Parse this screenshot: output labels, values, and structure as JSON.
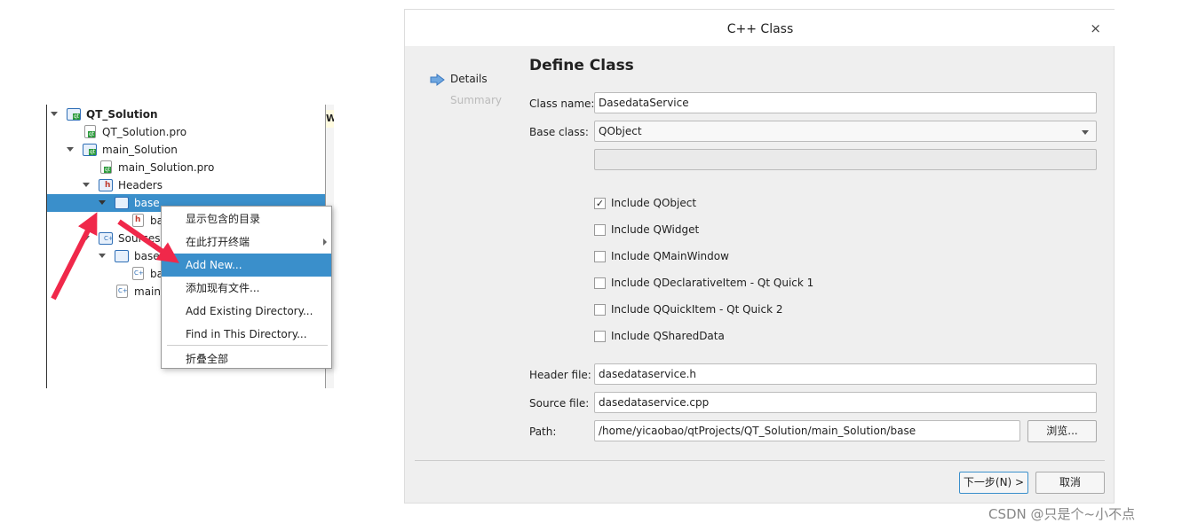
{
  "tree": {
    "items": [
      {
        "label": "QT_Solution",
        "bold": true
      },
      {
        "label": "QT_Solution.pro"
      },
      {
        "label": "main_Solution"
      },
      {
        "label": "main_Solution.pro"
      },
      {
        "label": "Headers"
      },
      {
        "label": "base",
        "selected": true
      },
      {
        "label": "ba"
      },
      {
        "label": "Sources"
      },
      {
        "label": "base"
      },
      {
        "label": "ba"
      },
      {
        "label": "main."
      }
    ],
    "side_letter": "W"
  },
  "context_menu": {
    "items": [
      "显示包含的目录",
      "在此打开终端",
      "Add New...",
      "添加现有文件...",
      "Add Existing Directory...",
      "Find in This Directory...",
      "折叠全部"
    ],
    "highlighted": "Add New..."
  },
  "dialog": {
    "title": "C++ Class",
    "close": "×",
    "nav": [
      "Details",
      "Summary"
    ],
    "heading": "Define Class",
    "class_name_label": "Class name:",
    "class_name": "DasedataService",
    "base_class_label": "Base class:",
    "base_class": "QObject",
    "includes": [
      {
        "label": "Include QObject",
        "checked": true
      },
      {
        "label": "Include QWidget",
        "checked": false
      },
      {
        "label": "Include QMainWindow",
        "checked": false
      },
      {
        "label": "Include QDeclarativeItem - Qt Quick 1",
        "checked": false
      },
      {
        "label": "Include QQuickItem - Qt Quick 2",
        "checked": false
      },
      {
        "label": "Include QSharedData",
        "checked": false
      }
    ],
    "header_label": "Header file:",
    "header": "dasedataservice.h",
    "source_label": "Source file:",
    "source": "dasedataservice.cpp",
    "path_label": "Path:",
    "path": "/home/yicaobao/qtProjects/QT_Solution/main_Solution/base",
    "browse": "浏览...",
    "next": "下一步(N) >",
    "cancel": "取消"
  },
  "watermark": "CSDN @只是个~小不点",
  "colors": {
    "selection": "#3a8fcb",
    "arrow": "#f0284a",
    "dialog_bg": "#efefef"
  }
}
